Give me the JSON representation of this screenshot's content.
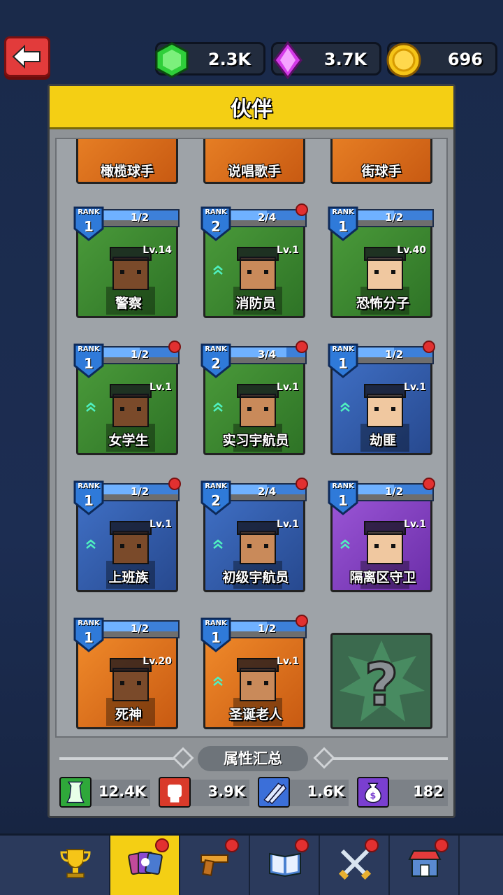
{
  "header": {
    "back_icon": "back-arrow-icon",
    "currencies": [
      {
        "icon": "green-gem-icon",
        "value": "2.3K",
        "color": "#2fcf3a"
      },
      {
        "icon": "purple-crystal-icon",
        "value": "3.7K",
        "color": "#d43ae8"
      },
      {
        "icon": "gold-coin-icon",
        "value": "696",
        "color": "#f5c518"
      }
    ]
  },
  "panel": {
    "title": "伙伴"
  },
  "top_partial_cards": [
    {
      "name": "橄榄球手"
    },
    {
      "name": "说唱歌手"
    },
    {
      "name": "街球手"
    }
  ],
  "cards": [
    {
      "name": "警察",
      "rank_label": "RANK",
      "rank": "1",
      "progress": "1/2",
      "progress_frac": 0.5,
      "level": "Lv.14",
      "bg": "green",
      "upgrade": false,
      "alert": false
    },
    {
      "name": "消防员",
      "rank_label": "RANK",
      "rank": "2",
      "progress": "2/4",
      "progress_frac": 0.5,
      "level": "Lv.1",
      "bg": "green",
      "upgrade": true,
      "alert": true
    },
    {
      "name": "恐怖分子",
      "rank_label": "RANK",
      "rank": "1",
      "progress": "1/2",
      "progress_frac": 0.5,
      "level": "Lv.40",
      "bg": "green",
      "upgrade": false,
      "alert": false
    },
    {
      "name": "女学生",
      "rank_label": "RANK",
      "rank": "1",
      "progress": "1/2",
      "progress_frac": 0.5,
      "level": "Lv.1",
      "bg": "green",
      "upgrade": true,
      "alert": true
    },
    {
      "name": "实习宇航员",
      "rank_label": "RANK",
      "rank": "2",
      "progress": "3/4",
      "progress_frac": 0.75,
      "level": "Lv.1",
      "bg": "green",
      "upgrade": true,
      "alert": true
    },
    {
      "name": "劫匪",
      "rank_label": "RANK",
      "rank": "1",
      "progress": "1/2",
      "progress_frac": 0.5,
      "level": "Lv.1",
      "bg": "blue",
      "upgrade": true,
      "alert": true
    },
    {
      "name": "上班族",
      "rank_label": "RANK",
      "rank": "1",
      "progress": "1/2",
      "progress_frac": 0.5,
      "level": "Lv.1",
      "bg": "blue",
      "upgrade": true,
      "alert": true
    },
    {
      "name": "初级宇航员",
      "rank_label": "RANK",
      "rank": "2",
      "progress": "2/4",
      "progress_frac": 0.5,
      "level": "Lv.1",
      "bg": "blue",
      "upgrade": true,
      "alert": true
    },
    {
      "name": "隔离区守卫",
      "rank_label": "RANK",
      "rank": "1",
      "progress": "1/2",
      "progress_frac": 0.5,
      "level": "Lv.1",
      "bg": "purple",
      "upgrade": true,
      "alert": true
    },
    {
      "name": "死神",
      "rank_label": "RANK",
      "rank": "1",
      "progress": "1/2",
      "progress_frac": 0.5,
      "level": "Lv.20",
      "bg": "orange",
      "upgrade": false,
      "alert": false
    },
    {
      "name": "圣诞老人",
      "rank_label": "RANK",
      "rank": "1",
      "progress": "1/2",
      "progress_frac": 0.5,
      "level": "Lv.1",
      "bg": "orange",
      "upgrade": true,
      "alert": true
    }
  ],
  "mystery_card": {
    "icon": "question-mark-icon",
    "label": "?"
  },
  "summary": {
    "title": "属性汇总",
    "stats": [
      {
        "icon": "tower-icon",
        "value": "12.4K",
        "color": "#2fa83a"
      },
      {
        "icon": "fist-icon",
        "value": "3.9K",
        "color": "#d93a2a"
      },
      {
        "icon": "ammo-icon",
        "value": "1.6K",
        "color": "#3b6fd9"
      },
      {
        "icon": "money-bag-icon",
        "value": "182",
        "color": "#7a3fd0"
      }
    ]
  },
  "bottom_nav": [
    {
      "icon": "trophy-icon",
      "active": false,
      "alert": false
    },
    {
      "icon": "partner-cards-icon",
      "active": true,
      "alert": true
    },
    {
      "icon": "pistol-icon",
      "active": false,
      "alert": true
    },
    {
      "icon": "book-icon",
      "active": false,
      "alert": true
    },
    {
      "icon": "crossed-swords-icon",
      "active": false,
      "alert": true
    },
    {
      "icon": "shop-icon",
      "active": false,
      "alert": true
    }
  ]
}
